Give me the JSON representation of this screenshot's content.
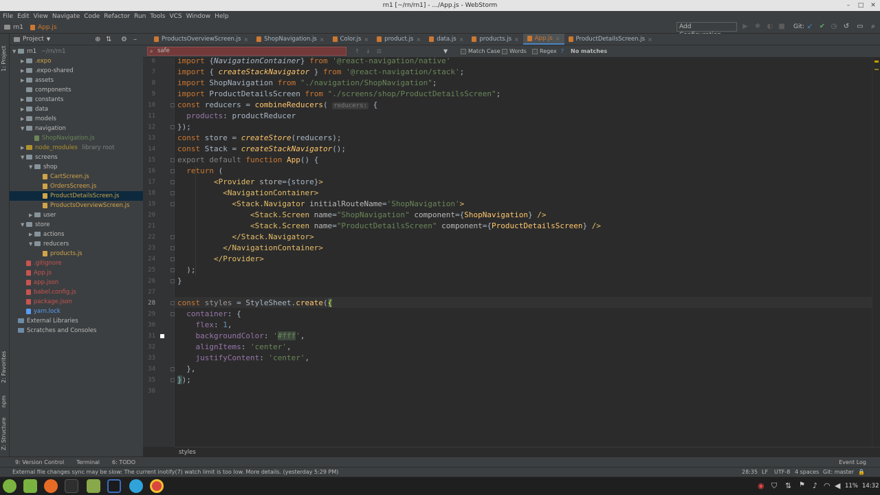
{
  "window": {
    "title": "rn1 [~/rn/rn1] - .../App.js - WebStorm"
  },
  "menu": [
    "File",
    "Edit",
    "View",
    "Navigate",
    "Code",
    "Refactor",
    "Run",
    "Tools",
    "VCS",
    "Window",
    "Help"
  ],
  "breadcrumb": {
    "project": "rn1",
    "file": "App.js"
  },
  "toolbar": {
    "add_config": "Add Configuration...",
    "git_label": "Git:"
  },
  "project_panel": {
    "title": "Project",
    "items": [
      {
        "label": "rn1",
        "suffix": "~/rn/rn1",
        "kind": "folder",
        "depth": 0,
        "open": true
      },
      {
        "label": ".expo",
        "kind": "folder",
        "depth": 1,
        "color": "#d0a449"
      },
      {
        "label": ".expo-shared",
        "kind": "folder",
        "depth": 1
      },
      {
        "label": "assets",
        "kind": "folder",
        "depth": 1
      },
      {
        "label": "components",
        "kind": "folder",
        "depth": 1,
        "noarrow": true
      },
      {
        "label": "constants",
        "kind": "folder",
        "depth": 1
      },
      {
        "label": "data",
        "kind": "folder",
        "depth": 1
      },
      {
        "label": "models",
        "kind": "folder",
        "depth": 1
      },
      {
        "label": "navigation",
        "kind": "folder",
        "depth": 1,
        "open": true
      },
      {
        "label": "ShopNavigation.js",
        "kind": "file",
        "depth": 2,
        "color": "#6a8759"
      },
      {
        "label": "node_modules",
        "suffix": "library root",
        "kind": "folder",
        "depth": 1,
        "color": "#b0922d",
        "lib": true
      },
      {
        "label": "screens",
        "kind": "folder",
        "depth": 1,
        "open": true
      },
      {
        "label": "shop",
        "kind": "folder",
        "depth": 2,
        "open": true
      },
      {
        "label": "CartScreen.js",
        "kind": "file",
        "depth": 3,
        "color": "#d0a449"
      },
      {
        "label": "OrdersScreen.js",
        "kind": "file",
        "depth": 3,
        "color": "#d0a449"
      },
      {
        "label": "ProductDetailsScreen.js",
        "kind": "file",
        "depth": 3,
        "color": "#d0a449",
        "selected": true
      },
      {
        "label": "ProductsOverviewScreen.js",
        "kind": "file",
        "depth": 3,
        "color": "#d0a449"
      },
      {
        "label": "user",
        "kind": "folder",
        "depth": 2
      },
      {
        "label": "store",
        "kind": "folder",
        "depth": 1,
        "open": true
      },
      {
        "label": "actions",
        "kind": "folder",
        "depth": 2
      },
      {
        "label": "reducers",
        "kind": "folder",
        "depth": 2,
        "open": true
      },
      {
        "label": "products.js",
        "kind": "file",
        "depth": 3,
        "color": "#d0a449"
      },
      {
        "label": ".gitignore",
        "kind": "file",
        "depth": 1,
        "color": "#c75450"
      },
      {
        "label": "App.js",
        "kind": "file",
        "depth": 1,
        "color": "#c75450"
      },
      {
        "label": "app.json",
        "kind": "file",
        "depth": 1,
        "color": "#c75450"
      },
      {
        "label": "babel.config.js",
        "kind": "file",
        "depth": 1,
        "color": "#c75450"
      },
      {
        "label": "package.json",
        "kind": "file",
        "depth": 1,
        "color": "#c75450"
      },
      {
        "label": "yarn.lock",
        "kind": "file",
        "depth": 1,
        "color": "#589df6"
      },
      {
        "label": "External Libraries",
        "kind": "lib",
        "depth": 0
      },
      {
        "label": "Scratches and Consoles",
        "kind": "lib",
        "depth": 0
      }
    ]
  },
  "tabs": [
    {
      "label": "ProductsOverviewScreen.js"
    },
    {
      "label": "ShopNavigation.js"
    },
    {
      "label": "Color.js"
    },
    {
      "label": "product.js"
    },
    {
      "label": "data.js"
    },
    {
      "label": "products.js"
    },
    {
      "label": "App.js",
      "active": true
    },
    {
      "label": "ProductDetailsScreen.js"
    }
  ],
  "find": {
    "query": "safe",
    "match_case": "Match Case",
    "words": "Words",
    "regex": "Regex",
    "help": "?",
    "result": "No matches"
  },
  "editor": {
    "first_line": 6,
    "current_line": 28,
    "footer_breadcrumb": "styles"
  },
  "side_tabs": {
    "project": "1: Project",
    "favorites": "2: Favorites",
    "npm": "npm",
    "structure": "Z: Structure"
  },
  "bottom_tools": [
    "9: Version Control",
    "Terminal",
    "6: TODO"
  ],
  "event_log": "Event Log",
  "status": {
    "message": "External file changes sync may be slow: The current inotify(7) watch limit is too low. More details. (yesterday 5:29 PM)",
    "position": "28:35",
    "line_sep": "LF",
    "encoding": "UTF-8",
    "indent": "4 spaces",
    "git": "Git: master"
  },
  "tray": {
    "battery": "11%",
    "clock": "14:32"
  }
}
